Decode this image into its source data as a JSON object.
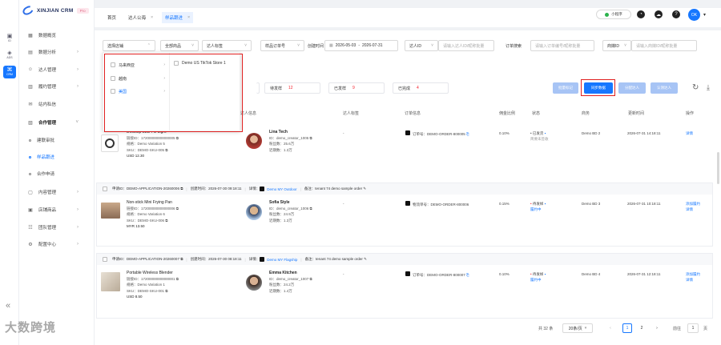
{
  "brand": {
    "name": "XINJIAN CRM",
    "tag": "Pro"
  },
  "rail": [
    {
      "label": "ID",
      "icon": "id-icon"
    },
    {
      "label": "ADS",
      "icon": "ads-icon"
    },
    {
      "label": "CRM",
      "icon": "crm-icon"
    }
  ],
  "menu": [
    {
      "label": "数据概览",
      "arrow": ""
    },
    {
      "label": "数据分析",
      "arrow": "›"
    },
    {
      "label": "达人管理",
      "arrow": "›"
    },
    {
      "label": "履约管理",
      "arrow": "›"
    },
    {
      "label": "站内私信",
      "arrow": ""
    },
    {
      "label": "合作管理",
      "arrow": "˅"
    }
  ],
  "submenu": [
    {
      "label": "建联审批"
    },
    {
      "label": "样品跟进"
    },
    {
      "label": "合作申请"
    }
  ],
  "menu2": [
    {
      "label": "内容管理",
      "arrow": "›"
    },
    {
      "label": "店铺商品",
      "arrow": "›"
    },
    {
      "label": "团队管理",
      "arrow": "›"
    },
    {
      "label": "配置中心",
      "arrow": "›"
    }
  ],
  "collapse": "«",
  "watermark": "大数跨境",
  "tabs": [
    {
      "label": "首页"
    },
    {
      "label": "达人公海",
      "close": "×"
    },
    {
      "label": "样品跟进",
      "close": "×"
    }
  ],
  "topright": {
    "mini": "小程序",
    "avatar": "OK"
  },
  "filters": {
    "store": "选择店铺",
    "product": "全部商品",
    "creator_tag": "达人标签",
    "order_no": "样品订单号",
    "time_label": "创建时间",
    "date_start": "2026-05-03",
    "date_to": "-",
    "date_end": "2026-07-31",
    "creator_id_sel": "达人ID",
    "creator_id_ph": "请输入达人ID/昵称批量",
    "order_search": "订单搜索",
    "order_ph": "请输入订单编号/昵称批量",
    "bd_sel": "商媒ID",
    "bd_ph": "请输入商媒ID/昵称批量"
  },
  "dropdown": {
    "items": [
      {
        "label": "马来西亚",
        "arrow": "›"
      },
      {
        "label": "越南",
        "arrow": "›"
      },
      {
        "label": "美国",
        "arrow": "›"
      }
    ],
    "store": "Demo US TikTok Store 1"
  },
  "stats": [
    {
      "label": "待发样",
      "value": "12"
    },
    {
      "label": "已发样",
      "value": "9"
    },
    {
      "label": "已完成",
      "value": "4"
    }
  ],
  "buttons": {
    "b1": "批量标记",
    "b2": "同步数据",
    "b3": "分配达人",
    "b4": "认领达人"
  },
  "columns": {
    "product": "商品信息",
    "creator": "达人信息",
    "tag": "达人标签",
    "order": "订单信息",
    "rate": "佣金比例",
    "status": "状态",
    "bd": "商务",
    "updated": "更新时间",
    "ops": "操作"
  },
  "orders": [
    {
      "apply_id": "",
      "created": "",
      "shop": "",
      "note": "",
      "product": {
        "title": "Desktop LED Fill Light",
        "lines": [
          "链接ID：17200000000000005 ⧉",
          "规格：Demo Variation 5",
          "SKU：DEMO-SKU-005 ⧉",
          "USD 12.30"
        ]
      },
      "creator": {
        "name": "Lina Tech",
        "lines": [
          "ID：demo_creator_1005 ⧉",
          "粉丝数：25.6万",
          "近期数：1.3万"
        ]
      },
      "tag": "-",
      "order": "订单号：DEMO-ORDER-800005",
      "rate": "0.10%",
      "status": [
        "已发货",
        "物流状态",
        "简要未签收"
      ],
      "bd": "Demo BD 2",
      "updated": "2026-07-31 14:18:11",
      "ops": [
        "详情"
      ]
    },
    {
      "apply_id": "申请ID：DEMO-APPLICATION-20260006 ⧉",
      "created": "创建时间：2026-07-30 09:18:11",
      "shop": "Demo MY Outdoor",
      "note": "备注：tenant 74 demo sample order ✎",
      "product": {
        "title": "Non-stick Mini Frying Pan",
        "lines": [
          "链接ID：17200000000000006 ⧉",
          "规格：Demo Variation 6",
          "SKU：DEMO-SKU-006 ⧉",
          "MYR 13.50"
        ]
      },
      "creator": {
        "name": "Sofia Style",
        "lines": [
          "ID：demo_creator_1006 ⧉",
          "粉丝数：24.9万",
          "近期数：1.3万"
        ]
      },
      "tag": "-",
      "order": "物流单号：DEMO-ORDER-800006",
      "rate": "0.15%",
      "status": [
        "待发样",
        "履约中"
      ],
      "bd": "Demo BD 3",
      "updated": "2026-07-31 10:18:11",
      "ops": [
        "添加履约",
        "详情"
      ]
    },
    {
      "apply_id": "申请ID：DEMO-APPLICATION-20260007 ⧉",
      "created": "创建时间：2026-07-30 08:18:11",
      "shop": "Demo MY Flagship",
      "note": "备注：tenant 74 demo sample order ✎",
      "product": {
        "title": "Portable Wireless Blender",
        "lines": [
          "链接ID：17200000000000001 ⧉",
          "规格：Demo Variation 1",
          "SKU：DEMO-SKU-001 ⧉",
          "USD 8.50"
        ]
      },
      "creator": {
        "name": "Emma Kitchen",
        "lines": [
          "ID：demo_creator_1007 ⧉",
          "粉丝数：24.2万",
          "近期数：1.4万"
        ]
      },
      "tag": "-",
      "order": "订单号：DEMO-ORDER-800007",
      "rate": "0.10%",
      "status": [
        "待发样",
        "履约中"
      ],
      "bd": "Demo BD 4",
      "updated": "2026-07-31 12:18:11",
      "ops": [
        "添加履约",
        "详情"
      ]
    }
  ],
  "pagination": {
    "total": "共 32 条",
    "size": "20条/页",
    "prev": "‹",
    "p1": "1",
    "p2": "2",
    "next": "›",
    "goto": "前往",
    "page": "1",
    "unit": "页"
  },
  "colors": {
    "primary": "#1677ff",
    "red": "#e02020",
    "danger": "#f5222d"
  }
}
